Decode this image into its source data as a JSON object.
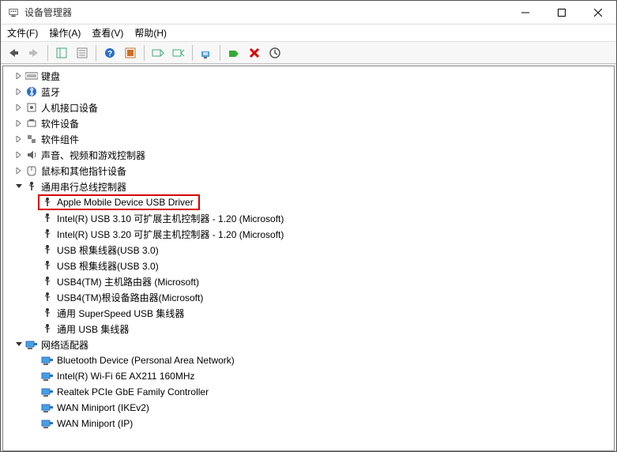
{
  "window": {
    "title": "设备管理器"
  },
  "menu": {
    "file": "文件(F)",
    "action": "操作(A)",
    "view": "查看(V)",
    "help": "帮助(H)"
  },
  "tree": {
    "keyboard": "键盘",
    "bluetooth": "蓝牙",
    "hid": "人机接口设备",
    "software_devices": "软件设备",
    "software_components": "软件组件",
    "sound": "声音、视频和游戏控制器",
    "mouse": "鼠标和其他指针设备",
    "usb_controllers": "通用串行总线控制器",
    "usb": {
      "apple": "Apple Mobile Device USB Driver",
      "intel310": "Intel(R) USB 3.10 可扩展主机控制器 - 1.20 (Microsoft)",
      "intel320": "Intel(R) USB 3.20 可扩展主机控制器 - 1.20 (Microsoft)",
      "roothub1": "USB 根集线器(USB 3.0)",
      "roothub2": "USB 根集线器(USB 3.0)",
      "usb4host": "USB4(TM) 主机路由器 (Microsoft)",
      "usb4root": "USB4(TM)根设备路由器(Microsoft)",
      "superspeed": "通用 SuperSpeed USB 集线器",
      "generic": "通用 USB 集线器"
    },
    "network_adapters": "网络适配器",
    "net": {
      "btpan": "Bluetooth Device (Personal Area Network)",
      "wifi": "Intel(R) Wi-Fi 6E AX211 160MHz",
      "realtek": "Realtek PCIe GbE Family Controller",
      "wan_ikev2": "WAN Miniport (IKEv2)",
      "wan_ip": "WAN Miniport (IP)"
    }
  }
}
